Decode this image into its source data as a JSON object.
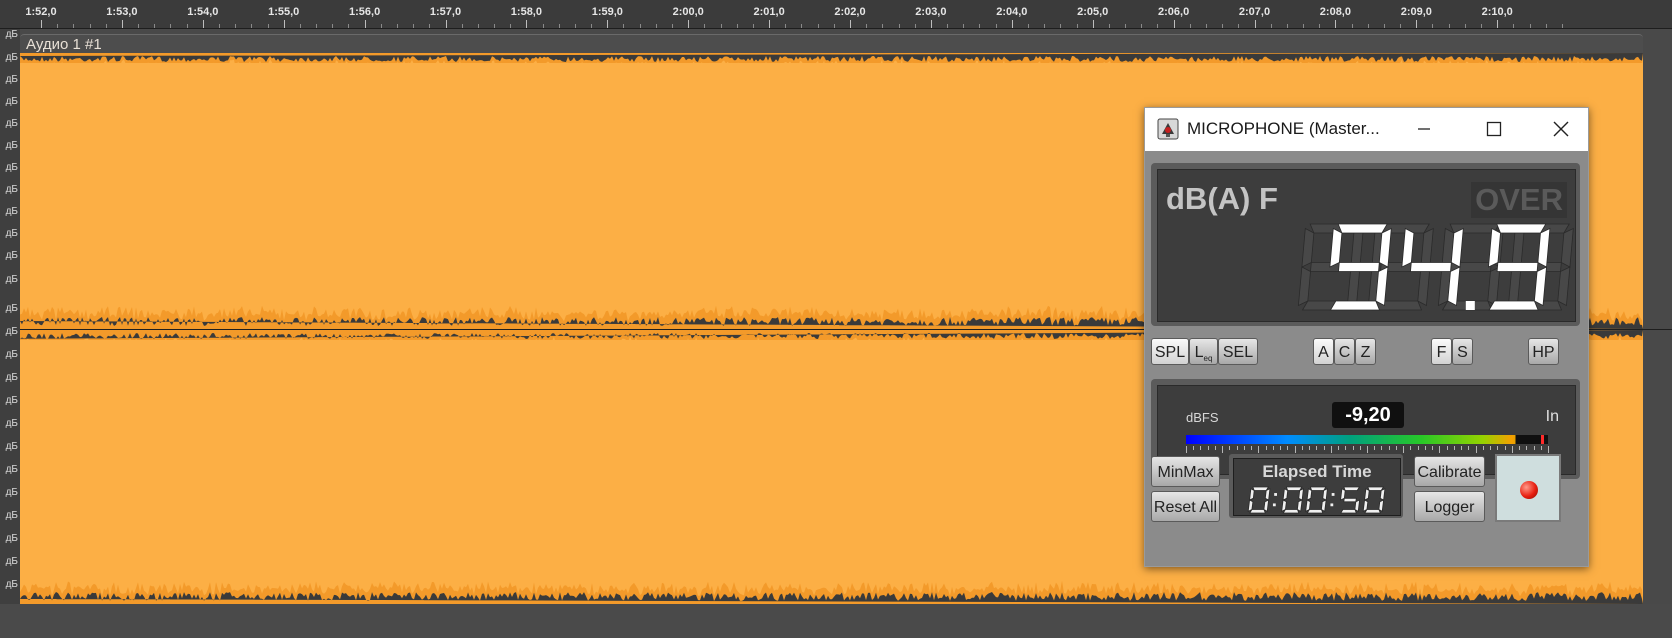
{
  "timeline": {
    "labels": [
      "1:52,0",
      "1:53,0",
      "1:54,0",
      "1:55,0",
      "1:56,0",
      "1:57,0",
      "1:58,0",
      "1:59,0",
      "2:00,0",
      "2:01,0",
      "2:02,0",
      "2:03,0",
      "2:04,0",
      "2:05,0",
      "2:06,0",
      "2:07,0",
      "2:08,0",
      "2:09,0",
      "2:10,0"
    ]
  },
  "db_scale": {
    "unit_label": "дБ"
  },
  "track": {
    "title": "Аудио 1 #1",
    "waveform_color": "#fcaf45",
    "waveform_edge_color": "#f39a2a"
  },
  "meter_window": {
    "title": "MICROPHONE (Master...",
    "measurement_label": "dB(A) F",
    "over_label": "OVER",
    "level_value": "94.9",
    "modes": {
      "spl": "SPL",
      "leq": "L",
      "leq_sub": "eq",
      "sel": "SEL",
      "weight_a": "A",
      "weight_c": "C",
      "weight_z": "Z",
      "fast": "F",
      "slow": "S",
      "hp": "HP"
    },
    "input_meter": {
      "unit_label": "dBFS",
      "value": "-9,20",
      "source_label": "In",
      "scale": [
        "-100",
        "-70",
        "-50",
        "-30",
        "-10",
        "0"
      ]
    },
    "buttons": {
      "minmax": "MinMax",
      "reset_all": "Reset All",
      "calibrate": "Calibrate",
      "logger": "Logger"
    },
    "timer": {
      "title": "Elapsed Time",
      "value": "0:00:50"
    }
  }
}
